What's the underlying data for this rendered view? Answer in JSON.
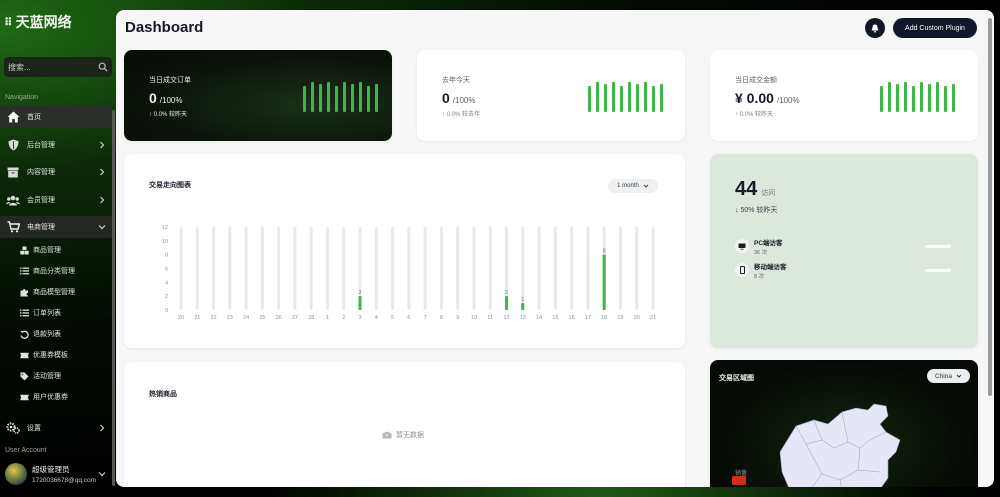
{
  "sidebar": {
    "logo": "天蓝网络",
    "search_placeholder": "搜索...",
    "nav_section": "Navigation",
    "account_section": "User Account",
    "items": [
      {
        "label": "首页",
        "icon": "home-icon"
      },
      {
        "label": "后台管理",
        "icon": "shield-icon"
      },
      {
        "label": "内容管理",
        "icon": "archive-icon"
      },
      {
        "label": "会员管理",
        "icon": "users-icon"
      },
      {
        "label": "电商管理",
        "icon": "cart-icon"
      }
    ],
    "subitems": [
      {
        "label": "商品管理",
        "icon": "cubes-icon"
      },
      {
        "label": "商品分类管理",
        "icon": "list-icon"
      },
      {
        "label": "商品模型管理",
        "icon": "puzzle-icon"
      },
      {
        "label": "订单列表",
        "icon": "list-ordered-icon"
      },
      {
        "label": "退款列表",
        "icon": "refund-icon"
      },
      {
        "label": "优惠券模板",
        "icon": "ticket-icon"
      },
      {
        "label": "活动管理",
        "icon": "tag-icon"
      },
      {
        "label": "用户优惠券",
        "icon": "user-ticket-icon"
      }
    ],
    "settings": {
      "label": "设置",
      "icon": "gears-icon"
    },
    "user": {
      "name": "超级管理员",
      "email": "1720036678@qq.com"
    }
  },
  "header": {
    "title": "Dashboard",
    "add_button": "Add Custom Plugin"
  },
  "stats": [
    {
      "title": "当日成交订单",
      "value": "0",
      "suffix": "/100%",
      "delta": "↑ 0.0% 较昨天",
      "spark": [
        22,
        26,
        24,
        26,
        22,
        26,
        24,
        26,
        22,
        24
      ]
    },
    {
      "title": "去年今天",
      "value": "0",
      "suffix": "/100%",
      "delta": "↑ 0.0% 较去年",
      "spark": [
        22,
        26,
        24,
        26,
        22,
        26,
        24,
        26,
        22,
        24
      ]
    },
    {
      "title": "当日成交金额",
      "value": "¥ 0.00",
      "suffix": "/100%",
      "delta": "↑ 0.0% 较昨天",
      "spark": [
        22,
        26,
        24,
        26,
        22,
        26,
        24,
        26,
        22,
        24
      ]
    }
  ],
  "trend": {
    "title": "交易走向图表",
    "period": "1 month"
  },
  "chart_data": {
    "type": "bar",
    "title": "交易走向图表",
    "categories": [
      "20",
      "21",
      "22",
      "23",
      "24",
      "25",
      "26",
      "27",
      "28",
      "1",
      "2",
      "3",
      "4",
      "5",
      "6",
      "7",
      "8",
      "9",
      "10",
      "11",
      "12",
      "13",
      "14",
      "15",
      "16",
      "17",
      "18",
      "19",
      "20",
      "21"
    ],
    "values": [
      0,
      0,
      0,
      0,
      0,
      0,
      0,
      0,
      0,
      0,
      0,
      2,
      0,
      0,
      0,
      0,
      0,
      0,
      0,
      0,
      2,
      1,
      0,
      0,
      0,
      0,
      8,
      0,
      0,
      0
    ],
    "yticks": [
      0,
      2,
      4,
      6,
      8,
      10,
      12
    ],
    "ylim": [
      0,
      12
    ],
    "bar_color": "#3fb54a",
    "background_bar_color": "#e8e9ee"
  },
  "visits": {
    "count": "44",
    "unit": "访问",
    "change": "↓ 50% 较昨天",
    "rows": [
      {
        "label": "PC端访客",
        "count": "36 次",
        "icon": "monitor-icon"
      },
      {
        "label": "移动端访客",
        "count": "8 次",
        "icon": "phone-icon"
      }
    ]
  },
  "hot": {
    "title": "热销商品",
    "empty_text": "暂无数据"
  },
  "region": {
    "title": "交易区域图",
    "country": "China",
    "legend_label": "销量"
  },
  "colors": {
    "accent": "#3fb54a",
    "dark_button": "#101828",
    "visits_card": "#dce8db"
  }
}
